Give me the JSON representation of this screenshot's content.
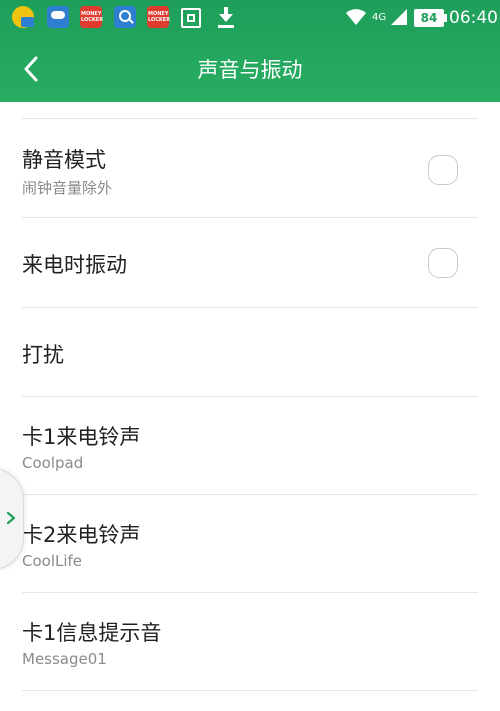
{
  "status_bar": {
    "time": "06:40",
    "battery": "84",
    "network": "4G",
    "notification_icons": [
      "weather-icon",
      "cloud-icon",
      "money-locker-icon",
      "search-app-icon",
      "money-locker-icon",
      "scan-icon",
      "download-icon"
    ],
    "money_locker_label": "MONEY LOCKER"
  },
  "header": {
    "title": "声音与振动",
    "back_icon": "chevron-left-icon",
    "color": "#24a65e"
  },
  "settings": [
    {
      "title": "静音模式",
      "subtitle": "闹钟音量除外",
      "checkbox": false
    },
    {
      "title": "来电时振动",
      "subtitle": "",
      "checkbox": false
    },
    {
      "title": "打扰",
      "subtitle": ""
    },
    {
      "title": "卡1来电铃声",
      "subtitle": "Coolpad"
    },
    {
      "title": "卡2来电铃声",
      "subtitle": "CoolLife"
    },
    {
      "title": "卡1信息提示音",
      "subtitle": "Message01"
    }
  ],
  "side_handle_icon": "chevron-right-icon"
}
